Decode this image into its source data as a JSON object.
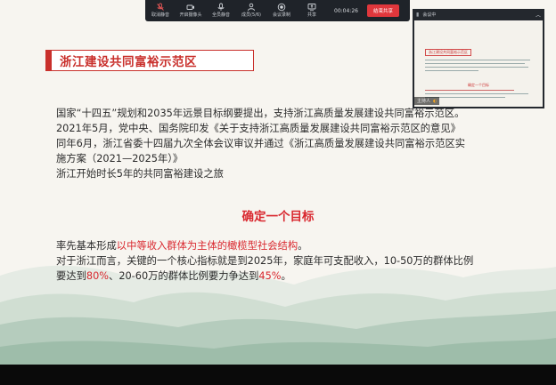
{
  "toolbar": {
    "items": [
      {
        "label": "取消静音"
      },
      {
        "label": "开启摄像头"
      },
      {
        "label": "全员静音"
      },
      {
        "label": "成员(5/6)"
      },
      {
        "label": "会议录制"
      },
      {
        "label": "共享"
      }
    ],
    "timer": "00:04:26",
    "end_label": "结束共享"
  },
  "panel": {
    "title": "会议中",
    "host_label": "主持人",
    "thumb_title": "浙江建设共同富裕示范区",
    "thumb_sub": "确定一个目标"
  },
  "slide": {
    "title": "浙江建设共同富裕示范区",
    "para1_lines": [
      "国家“十四五”规划和2035年远景目标纲要提出，支持浙江高质量发展建设共同富裕示范区。",
      "2021年5月，党中央、国务院印发《关于支持浙江高质量发展建设共同富裕示范区的意见》",
      "同年6月，浙江省委十四届九次全体会议审议并通过《浙江高质量发展建设共同富裕示范区实",
      "施方案（2021—2025年）》",
      "浙江开始时长5年的共同富裕建设之旅"
    ],
    "heading2": "确定一个目标",
    "goal": {
      "prefix": "率先基本形成",
      "highlight": "以中等收入群体为主体的橄榄型社会结构",
      "suffix": "。"
    },
    "detail": {
      "line1": "对于浙江而言，关键的一个核心指标就是到2025年，家庭年可支配收入，10-50万的群体比例",
      "line2_a": "要达到",
      "pct1": "80%",
      "line2_b": "、20-60万的群体比例要力争达到",
      "pct2": "45%",
      "line2_c": "。"
    }
  },
  "colors": {
    "accent_red": "#d9282f",
    "toolbar_bg": "#1f2329",
    "end_button": "#e0373c"
  }
}
